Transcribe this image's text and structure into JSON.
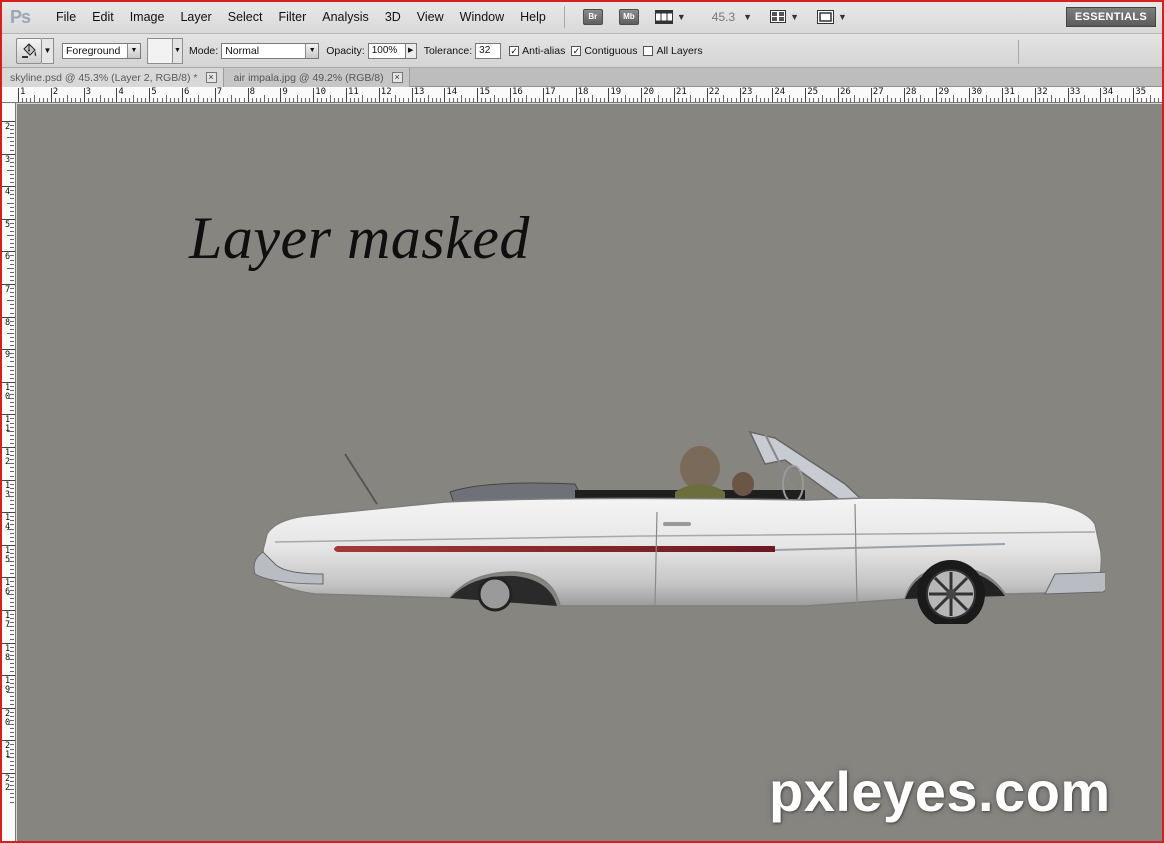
{
  "app": {
    "logo": "Ps"
  },
  "menu": [
    "File",
    "Edit",
    "Image",
    "Layer",
    "Select",
    "Filter",
    "Analysis",
    "3D",
    "View",
    "Window",
    "Help"
  ],
  "appbar": {
    "bridge_label": "Br",
    "minibridge_label": "Mb",
    "zoom_value": "45.3",
    "workspace": "ESSENTIALS"
  },
  "options": {
    "fill_source": "Foreground",
    "mode_label": "Mode:",
    "mode_value": "Normal",
    "opacity_label": "Opacity:",
    "opacity_value": "100%",
    "tolerance_label": "Tolerance:",
    "tolerance_value": "32",
    "antialias_label": "Anti-alias",
    "antialias_checked": true,
    "contiguous_label": "Contiguous",
    "contiguous_checked": true,
    "all_layers_label": "All Layers",
    "all_layers_checked": false
  },
  "tabs": [
    {
      "label": "skyline.psd @ 45.3% (Layer 2, RGB/8) *",
      "active": true
    },
    {
      "label": "air impala.jpg @ 49.2% (RGB/8)",
      "active": false
    }
  ],
  "ruler": {
    "top": [
      "1",
      "2",
      "3",
      "4",
      "5",
      "6",
      "7",
      "8",
      "9",
      "10",
      "11",
      "12",
      "13",
      "14",
      "15",
      "16",
      "17",
      "18",
      "19",
      "20",
      "21",
      "22",
      "23",
      "24",
      "25",
      "26",
      "27",
      "28",
      "29",
      "30",
      "31",
      "32",
      "33",
      "34",
      "35"
    ],
    "left": [
      "2",
      "3",
      "4",
      "5",
      "6",
      "7",
      "8",
      "9",
      "10",
      "11",
      "12",
      "13",
      "14",
      "15",
      "16",
      "17",
      "18",
      "19",
      "20",
      "21",
      "22"
    ]
  },
  "canvas": {
    "background": "#878580",
    "text": "Layer masked",
    "watermark": "pxleyes.com"
  },
  "colors": {
    "frame": "#d42020",
    "canvas_bg": "#878580"
  }
}
